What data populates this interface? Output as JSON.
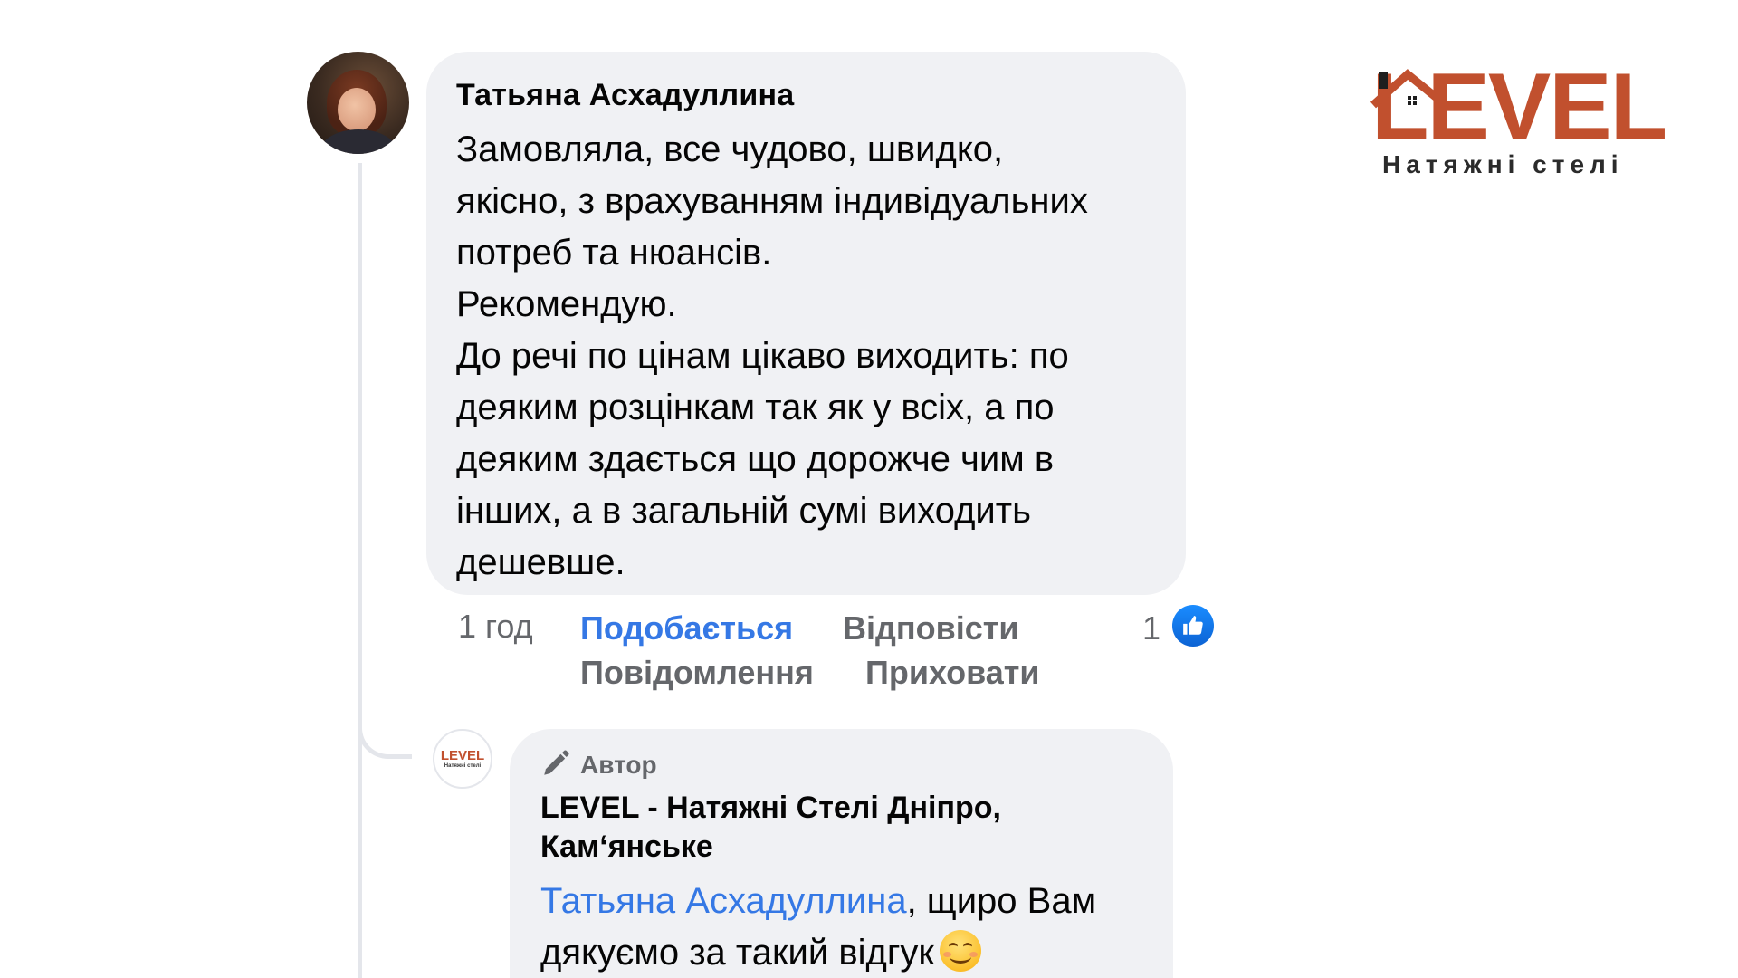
{
  "comment": {
    "author": "Татьяна Асхадуллина",
    "lines": [
      "Замовляла, все чудово, швидко,",
      "якісно, з врахуванням індивідуальних",
      "потреб та нюансів.",
      "Рекомендую.",
      "До речі по цінам цікаво виходить: по",
      "деяким розцінкам так як у всіх, а по",
      "деяким здається що дорожче чим в",
      "інших, а в загальній сумі виходить",
      "дешевше."
    ],
    "time": "1 год",
    "actions": {
      "like": "Подобається",
      "reply": "Відповісти",
      "message": "Повідомлення",
      "hide": "Приховати"
    },
    "reaction_count": "1"
  },
  "reply": {
    "badge": "Автор",
    "author": "LEVEL - Натяжні Стелі Дніпро, Кам‘янське",
    "author_lines": [
      "LEVEL - Натяжні Стелі Дніпро,",
      "Кам‘янське"
    ],
    "mention": "Татьяна Асхадуллина",
    "text_after_mention": ", щиро Вам",
    "text_line2": "дякуємо за такий відгук",
    "emoji": "smiling-face-icon"
  },
  "avatar_logo": {
    "word": "LEVEL",
    "sub": "Натяжні стелі"
  },
  "brand": {
    "word": "LEVEL",
    "subtitle": "Натяжні стелі"
  },
  "colors": {
    "bubble": "#f0f1f4",
    "link_blue": "#3578e5",
    "muted": "#65676b",
    "brand_red": "#c1502e"
  }
}
